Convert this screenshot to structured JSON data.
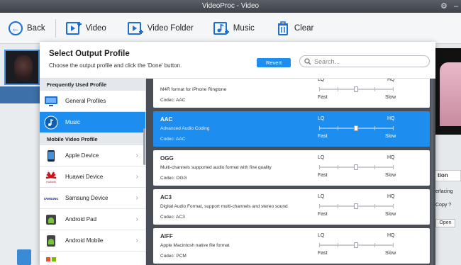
{
  "window": {
    "title": "VideoProc - Video"
  },
  "toolbar": {
    "back_label": "Back",
    "video_label": "Video",
    "video_folder_label": "Video Folder",
    "music_label": "Music",
    "clear_label": "Clear"
  },
  "background": {
    "option_button": "tion",
    "interlacing_text": "erlacing",
    "copy_text": "Copy ?",
    "open_button": "Open"
  },
  "modal": {
    "title": "Select Output Profile",
    "subtitle": "Choose the output profile and click the 'Done' button.",
    "revert_label": "Revert",
    "search_placeholder": "Search..."
  },
  "categories": {
    "frequent_header": "Frequently Used Profile",
    "frequent_items": [
      {
        "label": "General Profiles",
        "icon": "monitor-icon",
        "selected": false
      },
      {
        "label": "Music",
        "icon": "music-icon",
        "selected": true
      }
    ],
    "mobile_header": "Mobile Video Profile",
    "mobile_items": [
      {
        "label": "Apple Device",
        "icon": "apple-icon"
      },
      {
        "label": "Huawei Device",
        "icon": "huawei-icon"
      },
      {
        "label": "Samsung Device",
        "icon": "samsung-icon"
      },
      {
        "label": "Android Pad",
        "icon": "android-icon"
      },
      {
        "label": "Android Mobile",
        "icon": "android-icon"
      }
    ]
  },
  "profiles": [
    {
      "name": "",
      "desc": "M4R format for iPhone Ringtone",
      "codec": "Codec: AAC",
      "quality": 0.5,
      "selected": false
    },
    {
      "name": "AAC",
      "desc": "Advanced Audio Coding",
      "codec": "Codec: AAC",
      "quality": 0.5,
      "selected": true
    },
    {
      "name": "OGG",
      "desc": "Multi-channels supported audio format with fine quality",
      "codec": "Codec: OGG",
      "quality": 0.5,
      "selected": false
    },
    {
      "name": "AC3",
      "desc": "Digital Audio Format, support multi-channels and stereo sound",
      "codec": "Codec: AC3",
      "quality": 0.5,
      "selected": false
    },
    {
      "name": "AIFF",
      "desc": "Apple Macintosh native file format",
      "codec": "Codec: PCM",
      "quality": 0.5,
      "selected": false
    }
  ],
  "quality_labels": {
    "lq": "LQ",
    "hq": "HQ",
    "fast": "Fast",
    "slow": "Slow"
  },
  "colors": {
    "accent": "#1d8ef0",
    "toolbar_icon": "#1d6fd8"
  }
}
